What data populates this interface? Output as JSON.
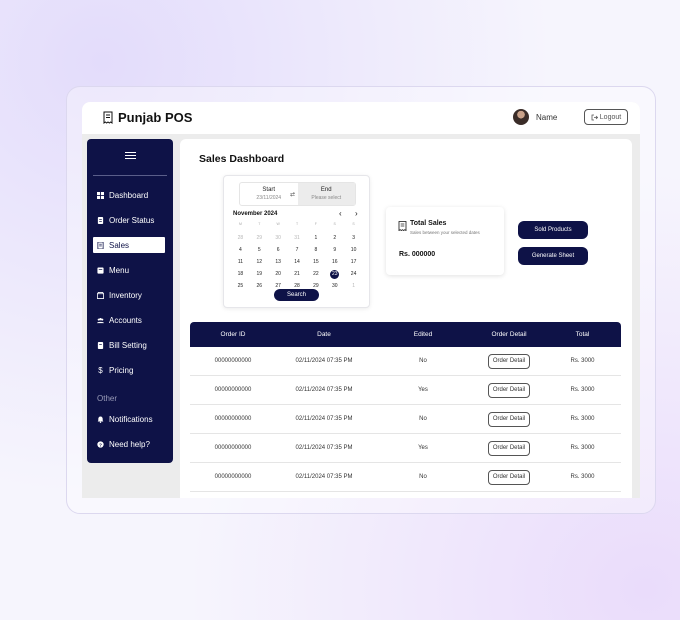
{
  "app": {
    "brand": "Punjab POS"
  },
  "header": {
    "user_name": "Name",
    "logout_label": "Logout"
  },
  "sidebar": {
    "items": [
      {
        "label": "Dashboard",
        "icon": "dashboard-icon"
      },
      {
        "label": "Order Status",
        "icon": "order-status-icon"
      },
      {
        "label": "Sales",
        "icon": "sales-icon",
        "active": true
      },
      {
        "label": "Menu",
        "icon": "menu-book-icon"
      },
      {
        "label": "Inventory",
        "icon": "inventory-icon"
      },
      {
        "label": "Accounts",
        "icon": "accounts-icon"
      },
      {
        "label": "Bill Setting",
        "icon": "bill-icon"
      },
      {
        "label": "Pricing",
        "icon": "dollar-icon"
      }
    ],
    "other_heading": "Other",
    "other_items": [
      {
        "label": "Notifications",
        "icon": "bell-icon"
      },
      {
        "label": "Need help?",
        "icon": "help-icon"
      }
    ]
  },
  "main": {
    "title": "Sales Dashboard"
  },
  "calendar": {
    "start_label": "Start",
    "start_value": "23/11/2024",
    "end_label": "End",
    "end_placeholder": "Please select",
    "month_label": "November 2024",
    "weekdays": [
      "M",
      "T",
      "W",
      "T",
      "F",
      "S",
      "S"
    ],
    "rows": [
      [
        "28",
        "29",
        "30",
        "31",
        "1",
        "2",
        "3"
      ],
      [
        "4",
        "5",
        "6",
        "7",
        "8",
        "9",
        "10"
      ],
      [
        "11",
        "12",
        "13",
        "14",
        "15",
        "16",
        "17"
      ],
      [
        "18",
        "19",
        "20",
        "21",
        "22",
        "23",
        "24"
      ],
      [
        "25",
        "26",
        "27",
        "28",
        "29",
        "30",
        "1"
      ]
    ],
    "selected_day": "23",
    "search_label": "Search"
  },
  "total_sales": {
    "title": "Total Sales",
    "subtitle": "Sales between your selected dates",
    "amount": "Rs. 000000"
  },
  "actions": {
    "sold_products": "Sold Products",
    "generate_sheet": "Generate Sheet"
  },
  "table": {
    "headers": [
      "Order ID",
      "Date",
      "Edited",
      "Order Detail",
      "Total"
    ],
    "rows": [
      {
        "order_id": "00000000000",
        "date": "02/11/2024 07:35 PM",
        "edited": "No",
        "detail": "Order Detail",
        "total": "Rs. 3000"
      },
      {
        "order_id": "00000000000",
        "date": "02/11/2024 07:35 PM",
        "edited": "Yes",
        "detail": "Order Detail",
        "total": "Rs. 3000"
      },
      {
        "order_id": "00000000000",
        "date": "02/11/2024 07:35 PM",
        "edited": "No",
        "detail": "Order Detail",
        "total": "Rs. 3000"
      },
      {
        "order_id": "00000000000",
        "date": "02/11/2024 07:35 PM",
        "edited": "Yes",
        "detail": "Order Detail",
        "total": "Rs. 3000"
      },
      {
        "order_id": "00000000000",
        "date": "02/11/2024 07:35 PM",
        "edited": "No",
        "detail": "Order Detail",
        "total": "Rs. 3000"
      }
    ]
  },
  "colors": {
    "primary": "#0e1247",
    "background": "#ececec"
  }
}
